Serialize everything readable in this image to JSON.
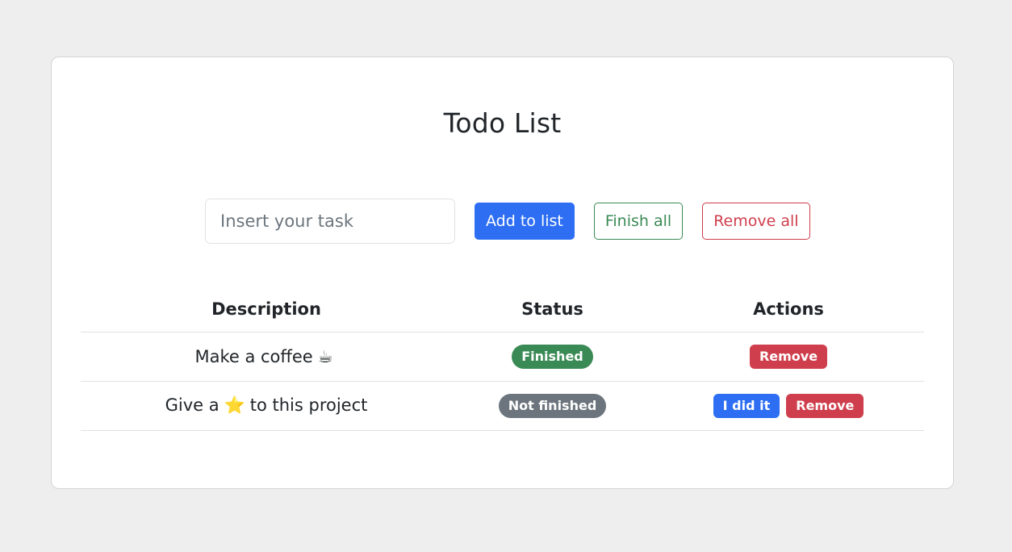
{
  "app": {
    "title": "Todo List"
  },
  "controls": {
    "input_placeholder": "Insert your task",
    "input_value": "",
    "add_label": "Add to list",
    "finish_all_label": "Finish all",
    "remove_all_label": "Remove all"
  },
  "table": {
    "headers": [
      "Description",
      "Status",
      "Actions"
    ],
    "rows": [
      {
        "description_before": "Make a coffee",
        "emoji": "☕",
        "description_after": "",
        "status": "Finished",
        "status_color": "#3a8a55",
        "actions": [
          "Remove"
        ]
      },
      {
        "description_before": "Give a",
        "emoji": "⭐",
        "description_after": "to this project",
        "status": "Not finished",
        "status_color": "#6c757d",
        "actions": [
          "I did it",
          "Remove"
        ]
      }
    ]
  },
  "colors": {
    "primary": "#2d6ef3",
    "success": "#3a8a55",
    "danger": "#cf3e4c",
    "secondary": "#6c757d"
  }
}
